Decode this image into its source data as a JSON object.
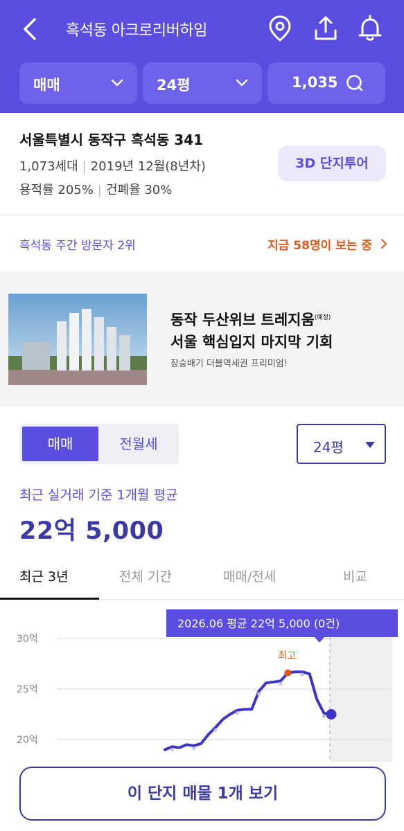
{
  "header": {
    "title": "흑석동 아크로리버하임",
    "filters": {
      "deal_type": "매매",
      "size": "24평",
      "listing_count": "1,035"
    }
  },
  "complex": {
    "address": "서울특별시 동작구 흑석동 341",
    "households": "1,073세대",
    "built": "2019년 12월(8년차)",
    "floor_area_ratio": "용적률 205%",
    "coverage_ratio": "건폐율 30%",
    "tour_button": "3D 단지투어"
  },
  "visitors": {
    "rank_text": "흑석동 주간 방문자 2위",
    "viewing_text": "지금 58명이 보는 중"
  },
  "ad": {
    "title_line1": "동작 두산위브 트레지움",
    "title_tag": "(예정)",
    "title_line2": "서울 핵심입지 마지막 기회",
    "subtitle": "장승배기 더블역세권 프리미엄!"
  },
  "price": {
    "toggle": [
      "매매",
      "전월세"
    ],
    "size_select": "24평",
    "avg_label": "최근 실거래 기준 1개월 평균",
    "avg_value": "22억 5,000"
  },
  "tabs": [
    "최근 3년",
    "전체 기간",
    "매매/전세",
    "비교"
  ],
  "chart_data": {
    "type": "line",
    "y_ticks": [
      "30억",
      "25억",
      "20억"
    ],
    "ylim": [
      18,
      31
    ],
    "tooltip": "2026.06 평균 22억 5,000 (0건)",
    "peak_label": "최고",
    "series": [
      {
        "values": [
          19.0,
          19.3,
          19.2,
          19.5,
          19.4,
          19.6,
          20.5,
          21.2,
          22.0,
          22.5,
          22.9,
          23.0,
          23.0,
          24.8,
          25.6,
          25.7,
          25.8,
          26.6,
          26.7,
          26.7,
          26.5,
          24.0,
          22.6,
          22.5
        ]
      }
    ],
    "peak_index": 17,
    "current_index": 23,
    "colors": {
      "line": "#3d33c4",
      "peak": "#e05a1e",
      "tooltip": "#5b4de0"
    }
  },
  "cta": {
    "label": "이 단지 매물 1개 보기"
  },
  "colors": {
    "brand": "#5b4de0",
    "accent_orange": "#e05a1e",
    "deep": "#3b3aa5"
  }
}
